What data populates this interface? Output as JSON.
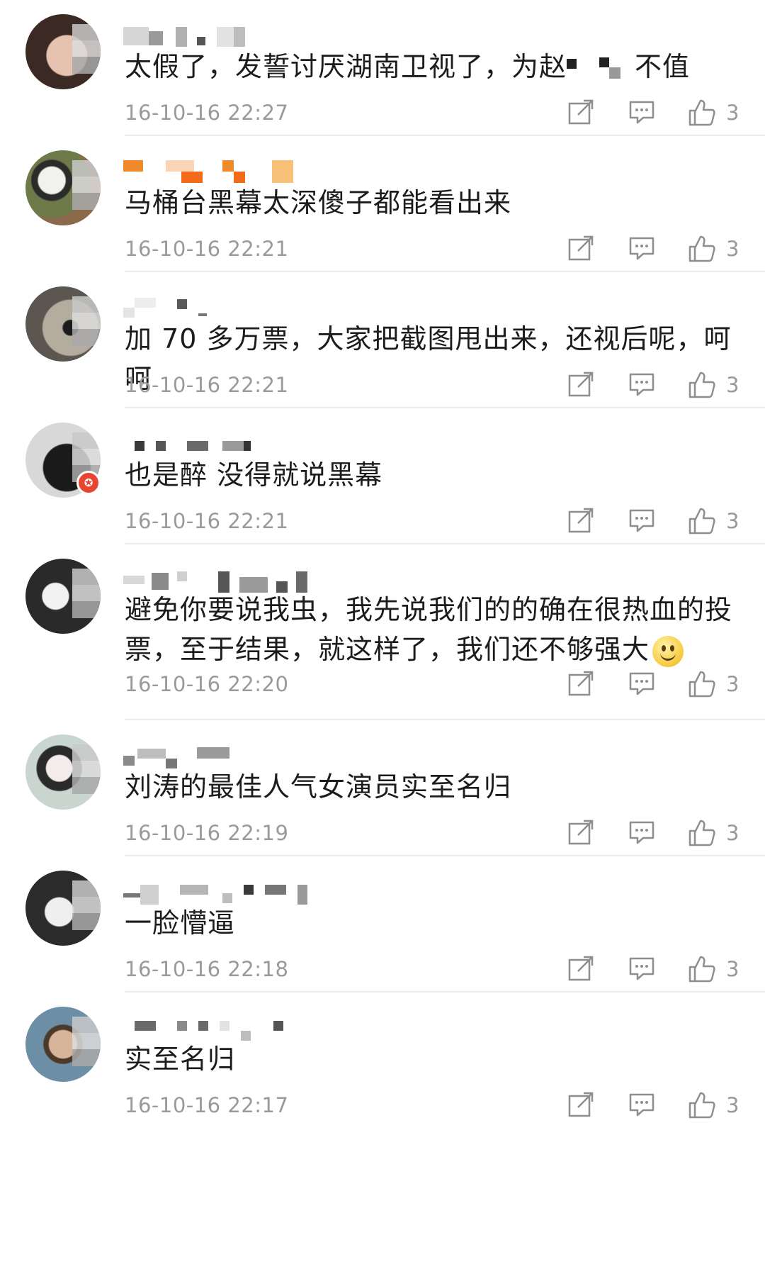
{
  "colors": {
    "text": "#1c1c1c",
    "meta": "#9a9a9a",
    "divider": "#ececec",
    "icon": "#8e8e8e",
    "badge": "#e8442f"
  },
  "icons": {
    "share": "share-icon",
    "reply": "comment-icon",
    "like": "thumbs-up-icon"
  },
  "comments": [
    {
      "text": "太假了，发誓讨厌湖南卫视了，为赵",
      "text_tail": "不值",
      "redacted": true,
      "timestamp": "16-10-16 22:27",
      "likes": "3",
      "avatar_colors": [
        "#3b2a24",
        "#e8c2b0"
      ]
    },
    {
      "text": "马桶台黑幕太深傻子都能看出来",
      "timestamp": "16-10-16 22:21",
      "likes": "3",
      "avatar_colors": [
        "#6f7a4a",
        "#f1f1ee"
      ]
    },
    {
      "text": "加 70 多万票，大家把截图甩出来，还视后呢，呵呵",
      "timestamp": "16-10-16 22:21",
      "likes": "3",
      "avatar_colors": [
        "#5b5650",
        "#b5aca0"
      ]
    },
    {
      "text": "也是醉 没得就说黑幕",
      "timestamp": "16-10-16 22:21",
      "likes": "3",
      "badge": "✪",
      "avatar_colors": [
        "#1a1a1a",
        "#d8d8d8"
      ]
    },
    {
      "text": "避免你要说我虫，我先说我们的的确在很热血的投票，至于结果，就这样了，我们还不够强大",
      "emoji": "smile-emoji",
      "timestamp": "16-10-16 22:20",
      "likes": "3",
      "avatar_colors": [
        "#2a2a2a",
        "#f2f2f2"
      ]
    },
    {
      "text": "刘涛的最佳人气女演员实至名归",
      "timestamp": "16-10-16 22:19",
      "likes": "3",
      "avatar_colors": [
        "#c9d6cf",
        "#f4ecea"
      ]
    },
    {
      "text": "一脸懵逼",
      "timestamp": "16-10-16 22:18",
      "likes": "3",
      "avatar_colors": [
        "#2b2b2b",
        "#efefef"
      ]
    },
    {
      "text": "实至名归",
      "timestamp": "16-10-16 22:17",
      "likes": "3",
      "avatar_colors": [
        "#6d8fa6",
        "#d8b49a"
      ]
    }
  ]
}
